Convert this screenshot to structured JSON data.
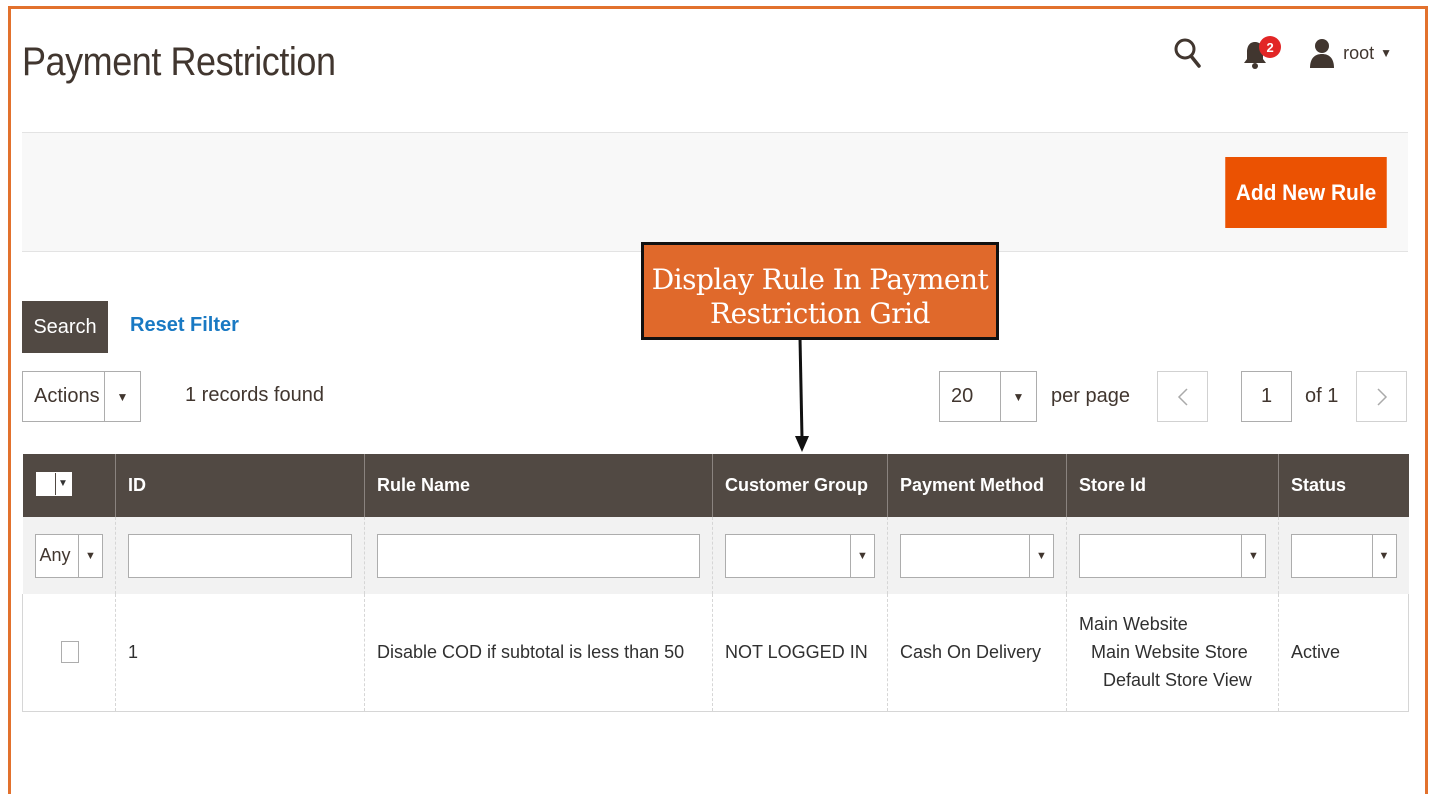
{
  "page": {
    "title": "Payment Restriction"
  },
  "header": {
    "notifications_count": "2",
    "user_name": "root"
  },
  "action_bar": {
    "add_label": "Add New Rule"
  },
  "callout": {
    "line1": "Display Rule In Payment",
    "line2": "Restriction Grid"
  },
  "toolbar": {
    "search_label": "Search",
    "reset_label": "Reset Filter",
    "actions_label": "Actions",
    "records_text": "1 records found",
    "per_page_value": "20",
    "per_page_label": "per page",
    "page_value": "1",
    "page_of": "of 1"
  },
  "grid": {
    "columns": [
      "ID",
      "Rule Name",
      "Customer Group",
      "Payment Method",
      "Store Id",
      "Status"
    ],
    "filter_any": "Any",
    "rows": [
      {
        "id": "1",
        "rule_name": "Disable COD if subtotal is less than 50",
        "customer_group": "NOT LOGGED IN",
        "payment_method": "Cash On Delivery",
        "store_lines": [
          "Main Website",
          "Main Website Store",
          "Default Store View"
        ],
        "status": "Active"
      }
    ]
  },
  "colors": {
    "accent": "#eb5202",
    "frame": "#e2712d",
    "header_bg": "#514943",
    "link": "#1979c3",
    "badge": "#e22626"
  },
  "icons": {
    "search": "search-icon",
    "bell": "bell-icon",
    "user": "user-icon",
    "prev": "chevron-left-icon",
    "next": "chevron-right-icon"
  }
}
